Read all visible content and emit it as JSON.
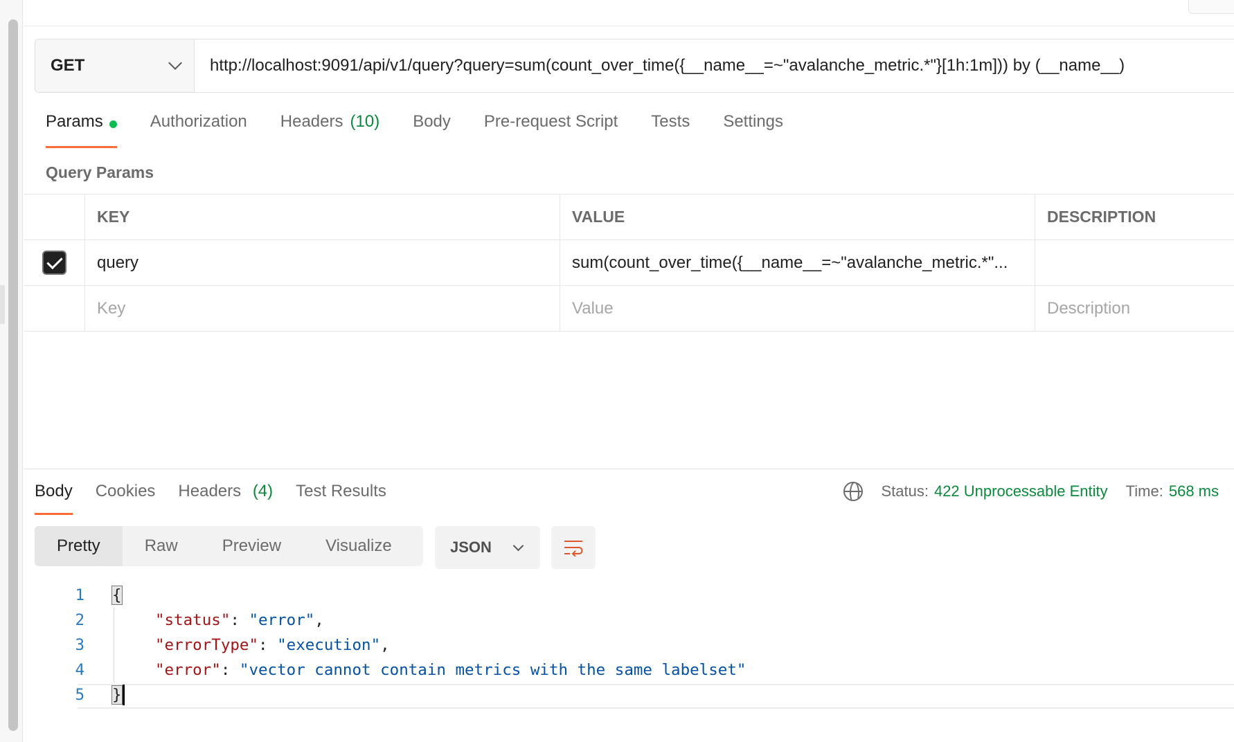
{
  "request": {
    "method": "GET",
    "url": "http://localhost:9091/api/v1/query?query=sum(count_over_time({__name__=~\"avalanche_metric.*\"}[1h:1m])) by (__name__)"
  },
  "request_tabs": [
    {
      "label": "Params",
      "active": true,
      "has_dot": true
    },
    {
      "label": "Authorization"
    },
    {
      "label": "Headers",
      "count": "(10)"
    },
    {
      "label": "Body"
    },
    {
      "label": "Pre-request Script"
    },
    {
      "label": "Tests"
    },
    {
      "label": "Settings"
    }
  ],
  "query_params": {
    "title": "Query Params",
    "headers": [
      "KEY",
      "VALUE",
      "DESCRIPTION"
    ],
    "rows": [
      {
        "checked": true,
        "key": "query",
        "value": "sum(count_over_time({__name__=~\"avalanche_metric.*\"...",
        "description": ""
      }
    ],
    "placeholders": {
      "key": "Key",
      "value": "Value",
      "description": "Description"
    }
  },
  "response_tabs": [
    {
      "label": "Body",
      "active": true
    },
    {
      "label": "Cookies"
    },
    {
      "label": "Headers",
      "count": "(4)"
    },
    {
      "label": "Test Results"
    }
  ],
  "status": {
    "status_label": "Status:",
    "status_value": "422 Unprocessable Entity",
    "time_label": "Time:",
    "time_value": "568 ms",
    "color": "#0a8a3a"
  },
  "view_modes": [
    "Pretty",
    "Raw",
    "Preview",
    "Visualize"
  ],
  "format": "JSON",
  "code": {
    "line_numbers": [
      "1",
      "2",
      "3",
      "4",
      "5"
    ],
    "open_brace": "{",
    "close_brace": "}",
    "fields": [
      {
        "key": "\"status\"",
        "value": "\"error\"",
        "trail": ","
      },
      {
        "key": "\"errorType\"",
        "value": "\"execution\"",
        "trail": ","
      },
      {
        "key": "\"error\"",
        "value": "\"vector cannot contain metrics with the same labelset\"",
        "trail": ""
      }
    ]
  },
  "colors": {
    "accent": "#ff6c37",
    "json_key": "#a31515",
    "json_string": "#0451a5",
    "line_number": "#2b7ac0"
  }
}
